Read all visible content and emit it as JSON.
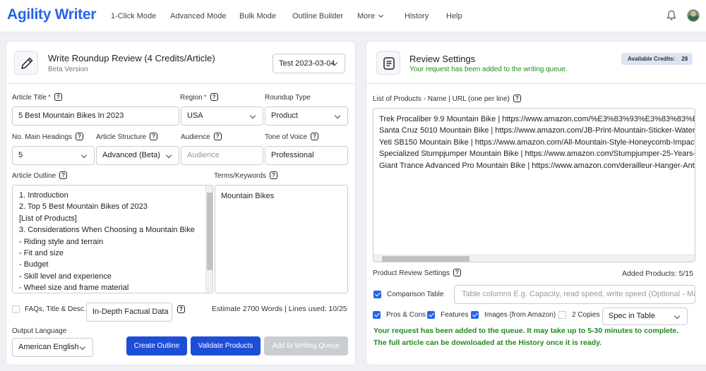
{
  "nav": {
    "logo": "Agility Writer",
    "items": [
      "1-Click Mode",
      "Advanced Mode",
      "Bulk Mode",
      "Outline Builder",
      "More",
      "History",
      "Help"
    ]
  },
  "left_panel": {
    "title": "Write Roundup Review (4 Credits/Article)",
    "subtitle": "Beta Version",
    "project_select": "Test 2023-03-04",
    "fields": {
      "article_title": {
        "label": "Article Title",
        "value": "5 Best Mountain Bikes In 2023"
      },
      "region": {
        "label": "Region",
        "value": "USA"
      },
      "roundup_type": {
        "label": "Roundup Type",
        "value": "Product"
      },
      "main_headings": {
        "label": "No. Main Headings",
        "value": "5"
      },
      "article_structure": {
        "label": "Article Structure",
        "value": "Advanced (Beta)"
      },
      "audience": {
        "label": "Audience",
        "placeholder": "Audience"
      },
      "tone_of_voice": {
        "label": "Tone of Voice",
        "value": "Professional"
      },
      "article_outline": {
        "label": "Article Outline",
        "lines": [
          "1. Introduction",
          "2. Top 5 Best Mountain Bikes of 2023",
          "[List of Products]",
          "3. Considerations When Choosing a Mountain Bike",
          "- Riding style and terrain",
          "- Fit and size",
          "- Budget",
          "- Skill level and experience",
          "- Wheel size and frame material"
        ]
      },
      "terms_keywords": {
        "label": "Terms/Keywords",
        "value": "Mountain Bikes"
      }
    },
    "faqs": {
      "label": "FAQs, Title & Desc.",
      "select": "In-Depth Factual Data"
    },
    "estimate": "Estimate 2700 Words | Lines used: 10/25",
    "output_language": {
      "label": "Output Language",
      "value": "American English"
    },
    "buttons": {
      "create_outline": "Create Outline",
      "validate_products": "Validate Products",
      "add_to_queue": "Add to Writing Queue"
    }
  },
  "right_panel": {
    "title": "Review Settings",
    "status": "Your request has been added to the writing queue.",
    "credits_label": "Available Credits:",
    "credits_value": "28",
    "products_label": "List of Products - Name | URL (one per line)",
    "products": [
      "Trek Procaliber 9.9 Mountain Bike | https://www.amazon.com/%E3%83%93%E3%83%83%E3%83%8",
      "Santa Cruz 5010 Mountain Bike | https://www.amazon.com/JB-Print-Mountain-Sticker-Waterpr",
      "Yeti SB150 Mountain Bike | https://www.amazon.com/All-Mountain-Style-Honeycomb-Impact",
      "Specialized Stumpjumper Mountain Bike | https://www.amazon.com/Stumpjumper-25-Years-M",
      "Giant Trance Advanced Pro Mountain Bike | https://www.amazon.com/derailleur-Hanger-Anth"
    ],
    "review_settings_label": "Product Review Settings",
    "added_products": "Added Products: 5/15",
    "comparison_table": {
      "label": "Comparison Table",
      "placeholder": "Table columns E.g. Capacity, read speed, write speed (Optional - Ma"
    },
    "options": {
      "pros_cons": "Pros & Cons",
      "features": "Features",
      "images": "Images (from Amazon)",
      "copies": "2 Copies",
      "spec_select": "Spec in Table"
    },
    "queue_note": "Your request has been added to the queue. It may take up to 5-30 minutes to complete.",
    "history_note": "The full article can be downloaded at the History once it is ready."
  },
  "colors": {
    "brand": "#2563eb",
    "button": "#1d4ed8",
    "success": "#1f8a1f",
    "required": "#e11d48"
  }
}
